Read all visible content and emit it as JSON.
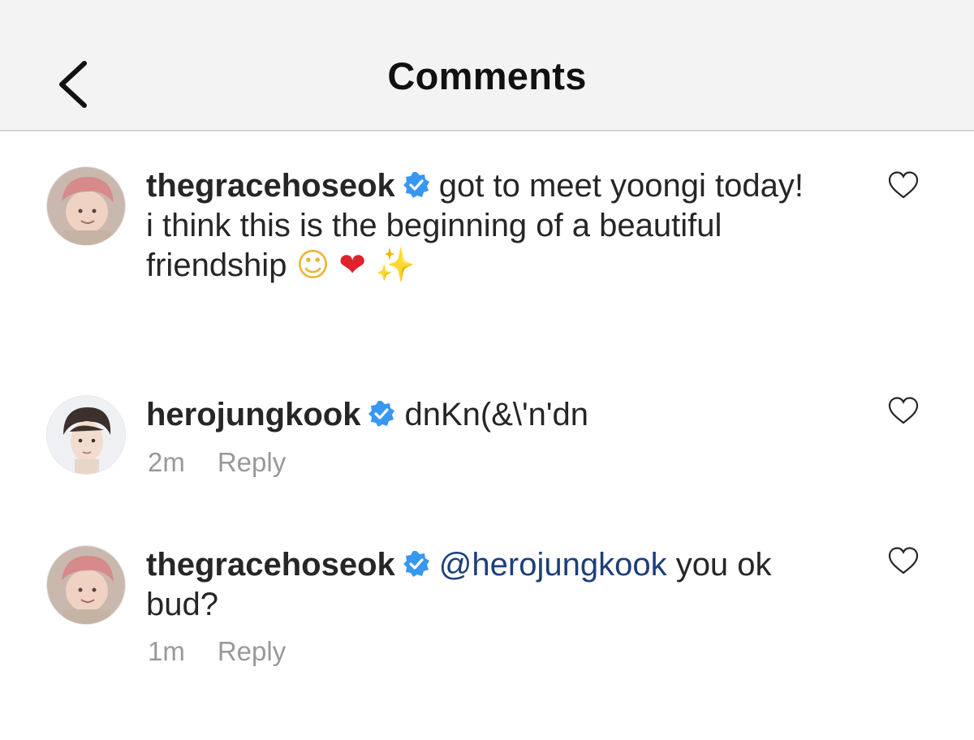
{
  "header": {
    "title": "Comments",
    "back_icon": "chevron-left-icon"
  },
  "comments": [
    {
      "username": "thegracehoseok",
      "verified": true,
      "text_line1": "got to meet yoongi today!",
      "text_line2": "i think this is the beginning of a beautiful",
      "text_line3": "friendship",
      "emojis": [
        "☺",
        "❤",
        "✨"
      ]
    },
    {
      "username": "herojungkook",
      "verified": true,
      "text": "dnKn(&\\'n'dn",
      "time": "2m",
      "reply_label": "Reply"
    },
    {
      "username": "thegracehoseok",
      "verified": true,
      "mention": "@herojungkook",
      "text_line1": "you ok",
      "text_line2": "bud?",
      "time": "1m",
      "reply_label": "Reply"
    }
  ],
  "colors": {
    "header_bg": "#f3f3f3",
    "verified_blue": "#3897f0",
    "mention_color": "#1d3f7a",
    "meta_gray": "#999999"
  }
}
